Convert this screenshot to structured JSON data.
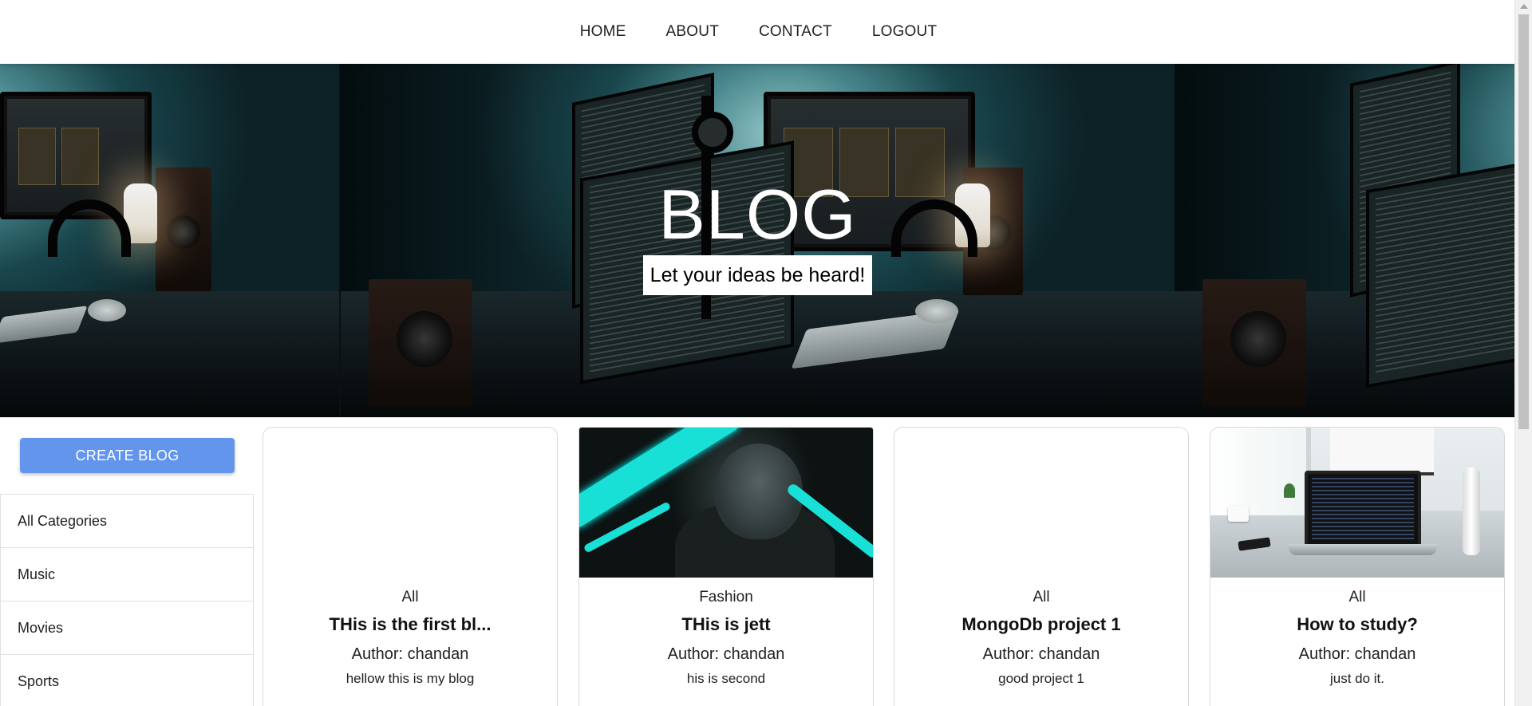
{
  "nav": {
    "links": [
      "HOME",
      "ABOUT",
      "CONTACT",
      "LOGOUT"
    ]
  },
  "hero": {
    "title": "BLOG",
    "subtitle": "Let your ideas be heard!"
  },
  "sidebar": {
    "create_label": "CREATE BLOG",
    "categories": [
      "All Categories",
      "Music",
      "Movies",
      "Sports"
    ]
  },
  "posts": [
    {
      "category": "All",
      "title": "THis is the first bl...",
      "author": "Author: chandan",
      "desc": "hellow this is my blog",
      "image": "none"
    },
    {
      "category": "Fashion",
      "title": "THis is jett",
      "author": "Author: chandan",
      "desc": "his is second",
      "image": "anime-character-art"
    },
    {
      "category": "All",
      "title": "MongoDb project 1",
      "author": "Author: chandan",
      "desc": "good project 1",
      "image": "none"
    },
    {
      "category": "All",
      "title": "How to study?",
      "author": "Author: chandan",
      "desc": "just do it.",
      "image": "laptop-desk-photo"
    }
  ],
  "colors": {
    "accent": "#6495ed",
    "jett_cyan": "#19e0d6"
  }
}
